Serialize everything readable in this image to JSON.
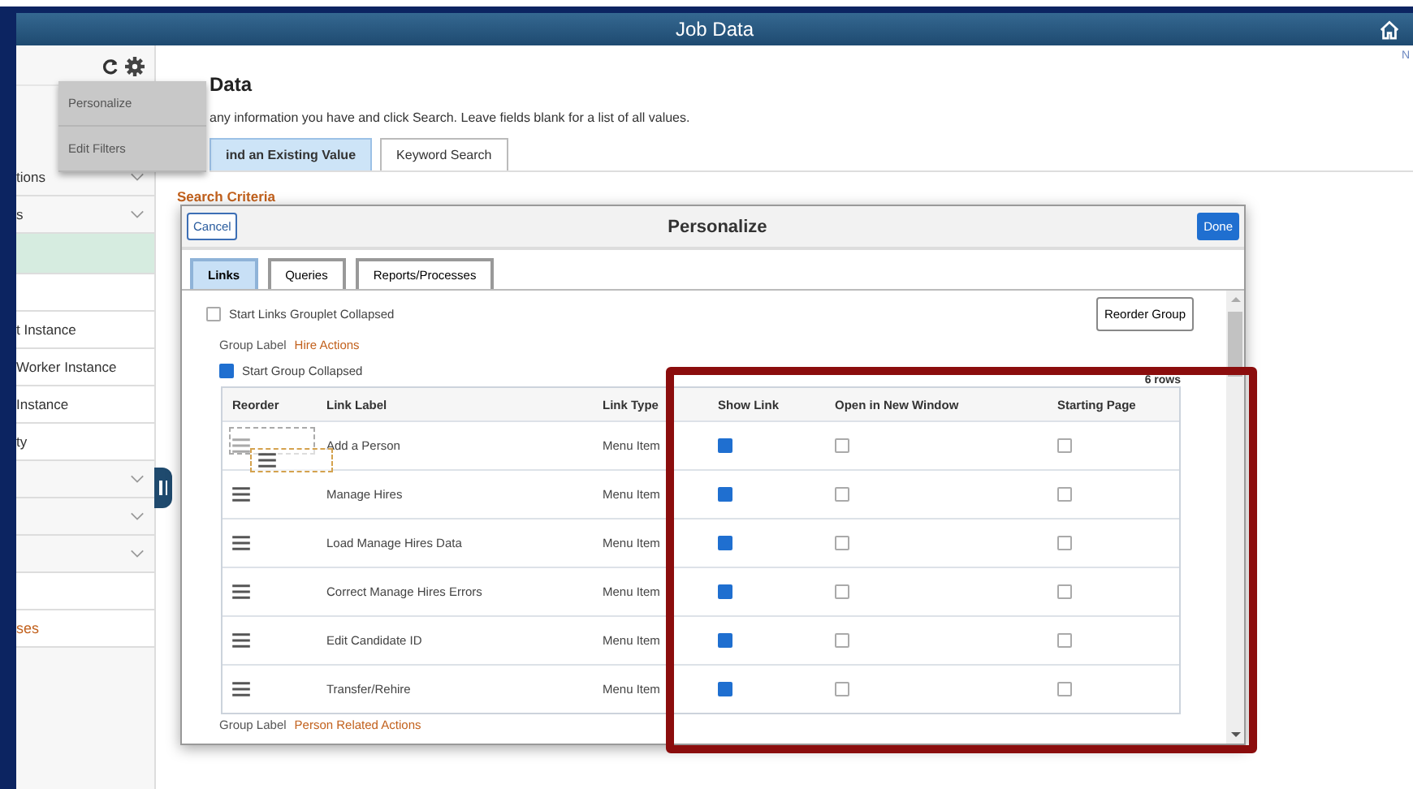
{
  "window": {
    "title": "Job Data",
    "corner_text": "N"
  },
  "sidebar": {
    "items": [
      {
        "kind": "group",
        "label": "tions",
        "selected": false
      },
      {
        "kind": "group",
        "label": "s",
        "selected": false
      },
      {
        "kind": "blank",
        "selected": true
      },
      {
        "kind": "blank",
        "selected": false
      },
      {
        "kind": "link",
        "label": "t Instance",
        "selected": false
      },
      {
        "kind": "link",
        "label": "Worker Instance",
        "selected": false
      },
      {
        "kind": "link",
        "label": "Instance",
        "selected": false
      },
      {
        "kind": "link",
        "label": "ty",
        "selected": false
      },
      {
        "kind": "group",
        "selected": false
      },
      {
        "kind": "group",
        "selected": false
      },
      {
        "kind": "group",
        "selected": false
      },
      {
        "kind": "blank",
        "selected": false
      },
      {
        "kind": "heading",
        "label": "ses",
        "selected": false
      }
    ]
  },
  "menu": {
    "items": [
      "Personalize",
      "Edit Filters"
    ]
  },
  "page": {
    "title": "Data",
    "instructions": "any information you have and click Search. Leave fields blank for a list of all values.",
    "tabs": [
      {
        "label": "ind an Existing Value",
        "selected": true
      },
      {
        "label": "Keyword Search",
        "selected": false
      }
    ],
    "section": "Search Criteria"
  },
  "dialog": {
    "title": "Personalize",
    "cancel": "Cancel",
    "done": "Done",
    "tabs": [
      {
        "label": "Links",
        "selected": true
      },
      {
        "label": "Queries",
        "selected": false
      },
      {
        "label": "Reports/Processes",
        "selected": false
      }
    ],
    "grouplet_option": {
      "label": "Start Links Grouplet Collapsed",
      "checked": false
    },
    "reorder_button": "Reorder Group",
    "group": {
      "caption": "Group Label",
      "label": "Hire Actions",
      "collapsed_option": {
        "label": "Start Group Collapsed",
        "checked": true
      },
      "row_count": "6 rows",
      "columns": [
        "Reorder",
        "Link Label",
        "Link Type",
        "Show Link",
        "Open in New Window",
        "Starting Page"
      ],
      "rows": [
        {
          "label": "Add a Person",
          "type": "Menu Item",
          "show_link": true,
          "new_window": false,
          "starting_page": false,
          "dragging": true
        },
        {
          "label": "Manage Hires",
          "type": "Menu Item",
          "show_link": true,
          "new_window": false,
          "starting_page": false,
          "dragging": false
        },
        {
          "label": "Load Manage Hires Data",
          "type": "Menu Item",
          "show_link": true,
          "new_window": false,
          "starting_page": false,
          "dragging": false
        },
        {
          "label": "Correct Manage Hires Errors",
          "type": "Menu Item",
          "show_link": true,
          "new_window": false,
          "starting_page": false,
          "dragging": false
        },
        {
          "label": "Edit Candidate ID",
          "type": "Menu Item",
          "show_link": true,
          "new_window": false,
          "starting_page": false,
          "dragging": false
        },
        {
          "label": "Transfer/Rehire",
          "type": "Menu Item",
          "show_link": true,
          "new_window": false,
          "starting_page": false,
          "dragging": false
        }
      ]
    },
    "next_group": {
      "caption": "Group Label",
      "label": "Person Related Actions"
    }
  }
}
